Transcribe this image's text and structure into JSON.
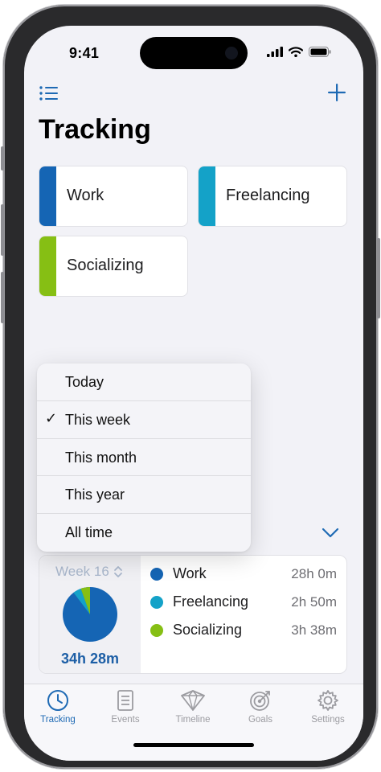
{
  "status": {
    "time": "9:41"
  },
  "header": {
    "title": "Tracking"
  },
  "activities": [
    {
      "label": "Work",
      "color": "#1565b4"
    },
    {
      "label": "Freelancing",
      "color": "#14a2c8"
    },
    {
      "label": "Socializing",
      "color": "#86bf14"
    }
  ],
  "dropdown": {
    "items": [
      "Today",
      "This week",
      "This month",
      "This year",
      "All time"
    ],
    "selected": "This week",
    "check_glyph": "✓"
  },
  "summary": {
    "week_label": "Week 16",
    "total": "34h 28m",
    "rows": [
      {
        "name": "Work",
        "value": "28h 0m",
        "color": "#1565b4"
      },
      {
        "name": "Freelancing",
        "value": "2h 50m",
        "color": "#14a2c8"
      },
      {
        "name": "Socializing",
        "value": "3h 38m",
        "color": "#86bf14"
      }
    ]
  },
  "tabs": [
    {
      "label": "Tracking",
      "icon": "clock-icon",
      "active": true
    },
    {
      "label": "Events",
      "icon": "document-icon",
      "active": false
    },
    {
      "label": "Timeline",
      "icon": "timeline-icon",
      "active": false
    },
    {
      "label": "Goals",
      "icon": "target-icon",
      "active": false
    },
    {
      "label": "Settings",
      "icon": "gear-icon",
      "active": false
    }
  ],
  "colors": {
    "accent": "#1e6ab4",
    "muted": "#9b9ba0"
  }
}
